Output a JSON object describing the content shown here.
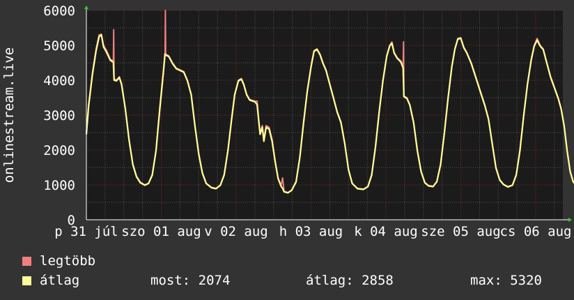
{
  "chart_data": {
    "type": "line",
    "ylabel": "onlinestream.live",
    "ylim": [
      0,
      6000
    ],
    "yticks": [
      0,
      1000,
      2000,
      3000,
      4000,
      5000,
      6000
    ],
    "xlim": [
      0,
      7.35
    ],
    "xticks": [
      {
        "label": "p 31 júl",
        "x": 0.0
      },
      {
        "label": "szo 01 aug",
        "x": 1.0
      },
      {
        "label": "v 02 aug",
        "x": 2.0
      },
      {
        "label": "h 03 aug",
        "x": 3.0
      },
      {
        "label": "k 04 aug",
        "x": 4.0
      },
      {
        "label": "sze 05 aug",
        "x": 5.0
      },
      {
        "label": "cs 06 aug",
        "x": 6.0
      }
    ],
    "grid": true,
    "colors": {
      "max": "#f08080",
      "avg": "#ffff99",
      "grid_major": "#7a2a2a",
      "grid_minor": "#555555",
      "plot_bg": "#1b1b1b"
    },
    "series": [
      {
        "name": "legtöbb",
        "color": "#f08080",
        "points": [
          [
            0.0,
            2500
          ],
          [
            0.03,
            3300
          ],
          [
            0.08,
            4200
          ],
          [
            0.13,
            4900
          ],
          [
            0.17,
            5300
          ],
          [
            0.2,
            5320
          ],
          [
            0.23,
            5000
          ],
          [
            0.27,
            4850
          ],
          [
            0.32,
            4600
          ],
          [
            0.36,
            4550
          ],
          [
            0.365,
            5450
          ],
          [
            0.37,
            4050
          ],
          [
            0.4,
            4000
          ],
          [
            0.44,
            4100
          ],
          [
            0.47,
            3900
          ],
          [
            0.52,
            3200
          ],
          [
            0.57,
            2300
          ],
          [
            0.62,
            1600
          ],
          [
            0.67,
            1250
          ],
          [
            0.72,
            1080
          ],
          [
            0.78,
            1000
          ],
          [
            0.83,
            1050
          ],
          [
            0.88,
            1300
          ],
          [
            0.93,
            2000
          ],
          [
            0.98,
            3200
          ],
          [
            1.03,
            4300
          ],
          [
            1.05,
            4800
          ],
          [
            1.055,
            6000
          ],
          [
            1.06,
            4750
          ],
          [
            1.1,
            4700
          ],
          [
            1.15,
            4500
          ],
          [
            1.2,
            4350
          ],
          [
            1.3,
            4250
          ],
          [
            1.35,
            4000
          ],
          [
            1.4,
            3600
          ],
          [
            1.45,
            2700
          ],
          [
            1.5,
            1900
          ],
          [
            1.55,
            1350
          ],
          [
            1.6,
            1050
          ],
          [
            1.67,
            930
          ],
          [
            1.73,
            900
          ],
          [
            1.79,
            1000
          ],
          [
            1.84,
            1300
          ],
          [
            1.89,
            2000
          ],
          [
            1.94,
            2900
          ],
          [
            1.98,
            3600
          ],
          [
            2.03,
            4000
          ],
          [
            2.07,
            4050
          ],
          [
            2.1,
            3900
          ],
          [
            2.14,
            3600
          ],
          [
            2.18,
            3450
          ],
          [
            2.25,
            3400
          ],
          [
            2.28,
            3400
          ],
          [
            2.3,
            2900
          ],
          [
            2.32,
            2500
          ],
          [
            2.35,
            2700
          ],
          [
            2.37,
            2300
          ],
          [
            2.4,
            2700
          ],
          [
            2.44,
            2650
          ],
          [
            2.48,
            2300
          ],
          [
            2.52,
            1700
          ],
          [
            2.56,
            1200
          ],
          [
            2.6,
            980
          ],
          [
            2.62,
            1200
          ],
          [
            2.64,
            820
          ],
          [
            2.69,
            780
          ],
          [
            2.74,
            850
          ],
          [
            2.8,
            1100
          ],
          [
            2.85,
            1800
          ],
          [
            2.9,
            2800
          ],
          [
            2.95,
            3700
          ],
          [
            3.0,
            4400
          ],
          [
            3.04,
            4850
          ],
          [
            3.08,
            4900
          ],
          [
            3.12,
            4750
          ],
          [
            3.16,
            4500
          ],
          [
            3.2,
            4300
          ],
          [
            3.25,
            3900
          ],
          [
            3.3,
            3500
          ],
          [
            3.35,
            3100
          ],
          [
            3.4,
            2800
          ],
          [
            3.45,
            2200
          ],
          [
            3.5,
            1450
          ],
          [
            3.55,
            1050
          ],
          [
            3.62,
            900
          ],
          [
            3.7,
            880
          ],
          [
            3.76,
            960
          ],
          [
            3.81,
            1300
          ],
          [
            3.86,
            2100
          ],
          [
            3.91,
            3100
          ],
          [
            3.96,
            4000
          ],
          [
            4.01,
            4700
          ],
          [
            4.05,
            5000
          ],
          [
            4.08,
            5100
          ],
          [
            4.11,
            4800
          ],
          [
            4.15,
            4650
          ],
          [
            4.2,
            4550
          ],
          [
            4.23,
            4400
          ],
          [
            4.235,
            5100
          ],
          [
            4.24,
            3550
          ],
          [
            4.28,
            3500
          ],
          [
            4.32,
            3300
          ],
          [
            4.37,
            2800
          ],
          [
            4.42,
            2000
          ],
          [
            4.47,
            1400
          ],
          [
            4.52,
            1070
          ],
          [
            4.57,
            980
          ],
          [
            4.63,
            960
          ],
          [
            4.68,
            1100
          ],
          [
            4.73,
            1600
          ],
          [
            4.78,
            2500
          ],
          [
            4.83,
            3500
          ],
          [
            4.88,
            4400
          ],
          [
            4.92,
            4900
          ],
          [
            4.96,
            5200
          ],
          [
            5.0,
            5220
          ],
          [
            5.04,
            4950
          ],
          [
            5.08,
            4800
          ],
          [
            5.14,
            4500
          ],
          [
            5.2,
            4100
          ],
          [
            5.26,
            3700
          ],
          [
            5.32,
            3300
          ],
          [
            5.37,
            2900
          ],
          [
            5.42,
            2200
          ],
          [
            5.47,
            1500
          ],
          [
            5.52,
            1150
          ],
          [
            5.57,
            1020
          ],
          [
            5.63,
            950
          ],
          [
            5.69,
            1000
          ],
          [
            5.74,
            1300
          ],
          [
            5.79,
            2000
          ],
          [
            5.84,
            3000
          ],
          [
            5.89,
            3900
          ],
          [
            5.94,
            4600
          ],
          [
            5.98,
            5000
          ],
          [
            6.02,
            5200
          ],
          [
            6.06,
            5000
          ],
          [
            6.1,
            4900
          ],
          [
            6.15,
            4500
          ],
          [
            6.2,
            4100
          ],
          [
            6.25,
            3800
          ],
          [
            6.3,
            3500
          ],
          [
            6.34,
            3200
          ],
          [
            6.38,
            2700
          ],
          [
            6.42,
            2000
          ],
          [
            6.46,
            1400
          ],
          [
            6.5,
            1100
          ],
          [
            6.55,
            970
          ],
          [
            6.62,
            930
          ],
          [
            6.66,
            1050
          ],
          [
            6.7,
            1400
          ],
          [
            6.72,
            2230
          ]
        ]
      },
      {
        "name": "átlag",
        "color": "#ffff99",
        "points": [
          [
            0.0,
            2450
          ],
          [
            0.03,
            3250
          ],
          [
            0.08,
            4150
          ],
          [
            0.13,
            4850
          ],
          [
            0.17,
            5250
          ],
          [
            0.2,
            5300
          ],
          [
            0.23,
            4950
          ],
          [
            0.27,
            4800
          ],
          [
            0.32,
            4570
          ],
          [
            0.36,
            4520
          ],
          [
            0.37,
            4000
          ],
          [
            0.4,
            3980
          ],
          [
            0.44,
            4080
          ],
          [
            0.47,
            3880
          ],
          [
            0.52,
            3180
          ],
          [
            0.57,
            2280
          ],
          [
            0.62,
            1580
          ],
          [
            0.67,
            1230
          ],
          [
            0.72,
            1060
          ],
          [
            0.78,
            990
          ],
          [
            0.83,
            1040
          ],
          [
            0.88,
            1280
          ],
          [
            0.93,
            1980
          ],
          [
            0.98,
            3150
          ],
          [
            1.03,
            4250
          ],
          [
            1.05,
            4750
          ],
          [
            1.06,
            4720
          ],
          [
            1.1,
            4680
          ],
          [
            1.15,
            4480
          ],
          [
            1.2,
            4330
          ],
          [
            1.3,
            4230
          ],
          [
            1.35,
            3980
          ],
          [
            1.4,
            3580
          ],
          [
            1.45,
            2680
          ],
          [
            1.5,
            1880
          ],
          [
            1.55,
            1330
          ],
          [
            1.6,
            1040
          ],
          [
            1.67,
            920
          ],
          [
            1.73,
            890
          ],
          [
            1.79,
            990
          ],
          [
            1.84,
            1280
          ],
          [
            1.89,
            1980
          ],
          [
            1.94,
            2880
          ],
          [
            1.98,
            3580
          ],
          [
            2.03,
            3980
          ],
          [
            2.07,
            4030
          ],
          [
            2.1,
            3880
          ],
          [
            2.14,
            3580
          ],
          [
            2.18,
            3430
          ],
          [
            2.25,
            3380
          ],
          [
            2.28,
            3300
          ],
          [
            2.3,
            2850
          ],
          [
            2.32,
            2450
          ],
          [
            2.35,
            2650
          ],
          [
            2.37,
            2250
          ],
          [
            2.4,
            2650
          ],
          [
            2.44,
            2600
          ],
          [
            2.48,
            2250
          ],
          [
            2.52,
            1680
          ],
          [
            2.56,
            1180
          ],
          [
            2.6,
            960
          ],
          [
            2.62,
            900
          ],
          [
            2.64,
            800
          ],
          [
            2.69,
            770
          ],
          [
            2.74,
            840
          ],
          [
            2.8,
            1080
          ],
          [
            2.85,
            1780
          ],
          [
            2.9,
            2780
          ],
          [
            2.95,
            3680
          ],
          [
            3.0,
            4380
          ],
          [
            3.04,
            4830
          ],
          [
            3.08,
            4880
          ],
          [
            3.12,
            4730
          ],
          [
            3.16,
            4480
          ],
          [
            3.2,
            4280
          ],
          [
            3.25,
            3880
          ],
          [
            3.3,
            3480
          ],
          [
            3.35,
            3080
          ],
          [
            3.4,
            2780
          ],
          [
            3.45,
            2180
          ],
          [
            3.5,
            1430
          ],
          [
            3.55,
            1040
          ],
          [
            3.62,
            890
          ],
          [
            3.7,
            870
          ],
          [
            3.76,
            950
          ],
          [
            3.81,
            1280
          ],
          [
            3.86,
            2080
          ],
          [
            3.91,
            3080
          ],
          [
            3.96,
            3980
          ],
          [
            4.01,
            4680
          ],
          [
            4.05,
            4980
          ],
          [
            4.08,
            5060
          ],
          [
            4.11,
            4780
          ],
          [
            4.15,
            4630
          ],
          [
            4.2,
            4520
          ],
          [
            4.23,
            4350
          ],
          [
            4.24,
            3530
          ],
          [
            4.28,
            3480
          ],
          [
            4.32,
            3280
          ],
          [
            4.37,
            2780
          ],
          [
            4.42,
            1980
          ],
          [
            4.47,
            1380
          ],
          [
            4.52,
            1060
          ],
          [
            4.57,
            970
          ],
          [
            4.63,
            950
          ],
          [
            4.68,
            1090
          ],
          [
            4.73,
            1580
          ],
          [
            4.78,
            2480
          ],
          [
            4.83,
            3480
          ],
          [
            4.88,
            4380
          ],
          [
            4.92,
            4880
          ],
          [
            4.96,
            5180
          ],
          [
            5.0,
            5200
          ],
          [
            5.04,
            4930
          ],
          [
            5.08,
            4780
          ],
          [
            5.14,
            4480
          ],
          [
            5.2,
            4080
          ],
          [
            5.26,
            3680
          ],
          [
            5.32,
            3280
          ],
          [
            5.37,
            2880
          ],
          [
            5.42,
            2180
          ],
          [
            5.47,
            1480
          ],
          [
            5.52,
            1140
          ],
          [
            5.57,
            1010
          ],
          [
            5.63,
            940
          ],
          [
            5.69,
            990
          ],
          [
            5.74,
            1280
          ],
          [
            5.79,
            1980
          ],
          [
            5.84,
            2980
          ],
          [
            5.89,
            3880
          ],
          [
            5.94,
            4580
          ],
          [
            5.98,
            4980
          ],
          [
            6.02,
            5150
          ],
          [
            6.06,
            4980
          ],
          [
            6.1,
            4880
          ],
          [
            6.15,
            4480
          ],
          [
            6.2,
            4080
          ],
          [
            6.25,
            3780
          ],
          [
            6.3,
            3480
          ],
          [
            6.34,
            3180
          ],
          [
            6.38,
            2680
          ],
          [
            6.42,
            1980
          ],
          [
            6.46,
            1380
          ],
          [
            6.5,
            1090
          ],
          [
            6.55,
            960
          ],
          [
            6.62,
            920
          ],
          [
            6.66,
            1040
          ],
          [
            6.7,
            1380
          ],
          [
            6.72,
            2074
          ]
        ]
      }
    ]
  },
  "legend": {
    "max_label": "legtöbb",
    "avg_label": "átlag",
    "now_label": "most: 2074",
    "avg_stat_label": "átlag: 2858",
    "max_stat_label": "max: 5320"
  }
}
